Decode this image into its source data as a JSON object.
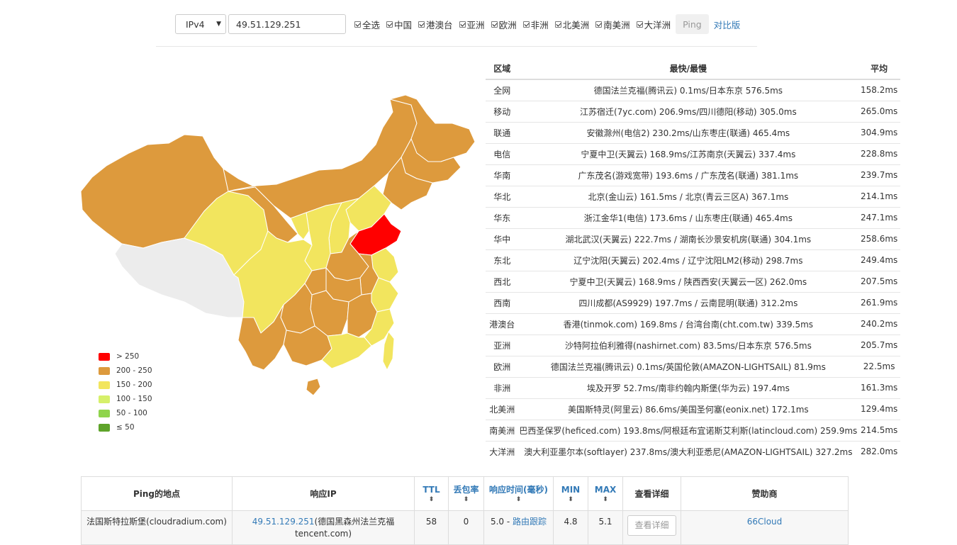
{
  "toolbar": {
    "ip_version": "IPv4",
    "ip_value": "49.51.129.251",
    "checkboxes": [
      "全选",
      "中国",
      "港澳台",
      "亚洲",
      "欧洲",
      "非洲",
      "北美洲",
      "南美洲",
      "大洋洲"
    ],
    "ping_label": "Ping",
    "compare_label": "对比版"
  },
  "legend": [
    {
      "label": "> 250",
      "color": "#ff0000"
    },
    {
      "label": "200 - 250",
      "color": "#dd9a3d"
    },
    {
      "label": "150 - 200",
      "color": "#f2e55e"
    },
    {
      "label": "100 - 150",
      "color": "#d6f06a"
    },
    {
      "label": "50 - 100",
      "color": "#8fd44c"
    },
    {
      "label": "≤ 50",
      "color": "#5ea32a"
    }
  ],
  "stats": {
    "headers": [
      "区域",
      "最快/最慢",
      "平均"
    ],
    "rows": [
      [
        "全网",
        "德国法兰克福(腾讯云) 0.1ms/日本东京 576.5ms",
        "158.2ms"
      ],
      [
        "移动",
        "江苏宿迁(7yc.com) 206.9ms/四川德阳(移动) 305.0ms",
        "265.0ms"
      ],
      [
        "联通",
        "安徽滁州(电信2) 230.2ms/山东枣庄(联通) 465.4ms",
        "304.9ms"
      ],
      [
        "电信",
        "宁夏中卫(天翼云) 168.9ms/江苏南京(天翼云) 337.4ms",
        "228.8ms"
      ],
      [
        "华南",
        "广东茂名(游戏宽带) 193.6ms / 广东茂名(联通) 381.1ms",
        "239.7ms"
      ],
      [
        "华北",
        "北京(金山云) 161.5ms / 北京(青云三区A) 367.1ms",
        "214.1ms"
      ],
      [
        "华东",
        "浙江金华1(电信) 173.6ms / 山东枣庄(联通) 465.4ms",
        "247.1ms"
      ],
      [
        "华中",
        "湖北武汉(天翼云) 222.7ms / 湖南长沙景安机房(联通) 304.1ms",
        "258.6ms"
      ],
      [
        "东北",
        "辽宁沈阳(天翼云) 202.4ms / 辽宁沈阳LM2(移动) 298.7ms",
        "249.4ms"
      ],
      [
        "西北",
        "宁夏中卫(天翼云) 168.9ms / 陕西西安(天翼云一区) 262.0ms",
        "207.5ms"
      ],
      [
        "西南",
        "四川成都(AS9929) 197.7ms / 云南昆明(联通) 312.2ms",
        "261.9ms"
      ],
      [
        "港澳台",
        "香港(tinmok.com) 169.8ms / 台湾台南(cht.com.tw) 339.5ms",
        "240.2ms"
      ],
      [
        "亚洲",
        "沙特阿拉伯利雅得(nashirnet.com) 83.5ms/日本东京 576.5ms",
        "205.7ms"
      ],
      [
        "欧洲",
        "德国法兰克福(腾讯云) 0.1ms/英国伦敦(AMAZON-LIGHTSAIL) 81.9ms",
        "22.5ms"
      ],
      [
        "非洲",
        "埃及开罗 52.7ms/南非约翰内斯堡(华为云) 197.4ms",
        "161.3ms"
      ],
      [
        "北美洲",
        "美国斯特灵(阿里云) 86.6ms/美国圣何塞(eonix.net) 172.1ms",
        "129.4ms"
      ],
      [
        "南美洲",
        "巴西圣保罗(heficed.com) 193.8ms/阿根廷布宜诺斯艾利斯(latincloud.com) 259.9ms",
        "214.5ms"
      ],
      [
        "大洋洲",
        "澳大利亚墨尔本(softlayer) 237.8ms/澳大利亚悉尼(AMAZON-LIGHTSAIL) 327.2ms",
        "282.0ms"
      ]
    ]
  },
  "results": {
    "headers": {
      "location": "Ping的地点",
      "ip": "响应IP",
      "ttl": "TTL",
      "loss": "丢包率",
      "time": "响应时间(毫秒)",
      "min": "MIN",
      "max": "MAX",
      "detail": "查看详细",
      "sponsor": "赞助商"
    },
    "sort_glyph": "⬍",
    "row": {
      "location": "法国斯特拉斯堡(cloudradium.com)",
      "ip": "49.51.129.251",
      "ip_geo_line1": "(德国黑森州法兰克福",
      "ip_geo_line2": "tencent.com)",
      "ttl": "58",
      "loss": "0",
      "time": "5.0",
      "time_sep": " - ",
      "trace": "路由跟踪",
      "min": "4.8",
      "max": "5.1",
      "detail_button": "查看详细",
      "sponsor": "66Cloud"
    }
  }
}
